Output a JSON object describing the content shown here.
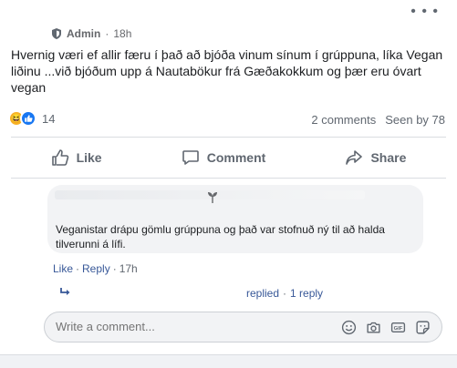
{
  "post": {
    "author": "Admin",
    "time": "18h",
    "text": "Hvernig væri ef allir færu í það að bjóða vinum sínum í grúppuna, líka Vegan liðinu ...við bjóðum upp á Nautabökur frá Gæðakokkum og þær eru óvart vegan",
    "reaction_count": "14",
    "comments_count": "2 comments",
    "seen_by": "Seen by 78"
  },
  "actions": {
    "like": "Like",
    "comment": "Comment",
    "share": "Share"
  },
  "comment": {
    "text": "Veganistar drápu gömlu grúppuna og það var stofnuð ný til að halda tilverunni á lífi.",
    "like": "Like",
    "reply": "Reply",
    "time": "17h",
    "separator": "·"
  },
  "replies": {
    "label": "replied",
    "count": "1 reply",
    "separator": "·"
  },
  "input": {
    "placeholder": "Write a comment..."
  },
  "colors": {
    "link": "#385898",
    "muted": "#606770",
    "like_blue": "#1877f2",
    "haha_yellow": "#f7b125"
  }
}
